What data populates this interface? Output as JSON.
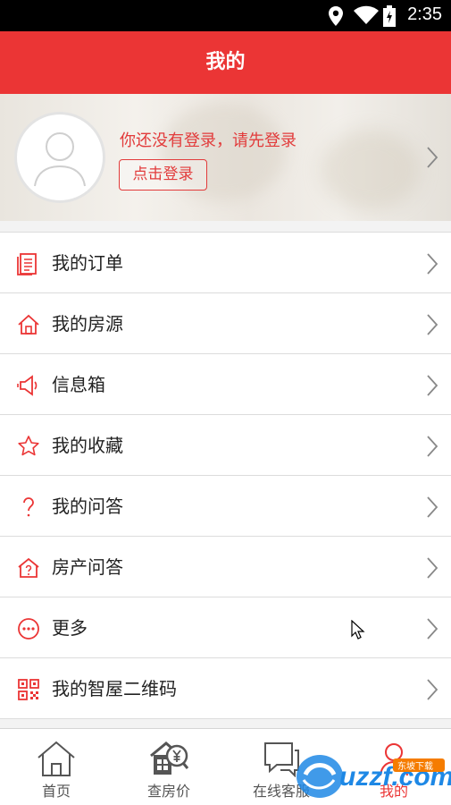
{
  "status_bar": {
    "time": "2:35"
  },
  "app_bar": {
    "title": "我的"
  },
  "profile": {
    "prompt": "你还没有登录，请先登录",
    "login_button": "点击登录"
  },
  "menu": {
    "items": [
      {
        "label": "我的订单",
        "icon": "order-icon"
      },
      {
        "label": "我的房源",
        "icon": "house-icon"
      },
      {
        "label": "信息箱",
        "icon": "speaker-icon"
      },
      {
        "label": "我的收藏",
        "icon": "star-icon"
      },
      {
        "label": "我的问答",
        "icon": "question-icon"
      },
      {
        "label": "房产问答",
        "icon": "house-question-icon"
      },
      {
        "label": "更多",
        "icon": "more-icon"
      },
      {
        "label": "我的智屋二维码",
        "icon": "qrcode-icon"
      }
    ]
  },
  "tab_bar": {
    "tabs": [
      {
        "label": "首页",
        "icon": "home-icon"
      },
      {
        "label": "查房价",
        "icon": "price-icon"
      },
      {
        "label": "在线客服",
        "icon": "chat-icon"
      },
      {
        "label": "我的",
        "icon": "user-icon"
      }
    ],
    "active_index": 3
  },
  "watermark": {
    "text": "uzzf.com",
    "sub": "东坡下载"
  },
  "colors": {
    "accent": "#eb3535",
    "text": "#222222",
    "divider": "#dcdcdc"
  }
}
